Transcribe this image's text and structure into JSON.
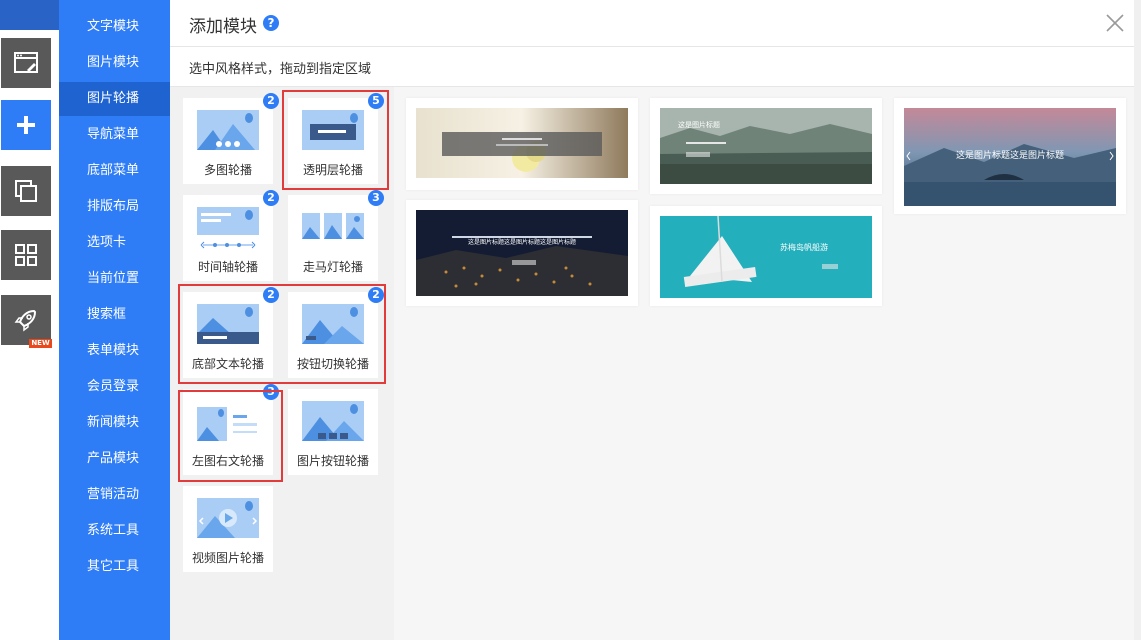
{
  "header": {
    "title": "添加模块",
    "help_icon": "?",
    "subtitle": "选中风格样式，拖动到指定区域"
  },
  "rail": {
    "new_badge": "NEW",
    "icons": [
      "layout-tools-icon",
      "add-icon",
      "pages-icon",
      "modules-grid-icon",
      "rocket-icon"
    ]
  },
  "categories": [
    "文字模块",
    "图片模块",
    "图片轮播",
    "导航菜单",
    "底部菜单",
    "排版布局",
    "选项卡",
    "当前位置",
    "搜索框",
    "表单模块",
    "会员登录",
    "新闻模块",
    "产品模块",
    "营销活动",
    "系统工具",
    "其它工具"
  ],
  "active_category": "图片轮播",
  "styles": [
    {
      "label": "多图轮播",
      "count": "2"
    },
    {
      "label": "透明层轮播",
      "count": "5"
    },
    {
      "label": "时间轴轮播",
      "count": "2"
    },
    {
      "label": "走马灯轮播",
      "count": "3"
    },
    {
      "label": "底部文本轮播",
      "count": "2"
    },
    {
      "label": "按钮切换轮播",
      "count": "2"
    },
    {
      "label": "左图右文轮播",
      "count": "3"
    },
    {
      "label": "图片按钮轮播",
      "count": ""
    },
    {
      "label": "视频图片轮播",
      "count": ""
    }
  ],
  "previews": [
    {
      "caption": ""
    },
    {
      "caption": "这是图片标题"
    },
    {
      "caption": "这是图片标题这是图片标题"
    },
    {
      "caption": "这是图片标题这是图片标题这是图片标题"
    },
    {
      "caption": "苏梅岛帆船游"
    }
  ],
  "colors": {
    "accent": "#2e7cf6",
    "category_bg": "#2e7cf6",
    "category_active": "#1e63d0",
    "highlight": "#e23b3b",
    "rail_button": "#595959"
  }
}
